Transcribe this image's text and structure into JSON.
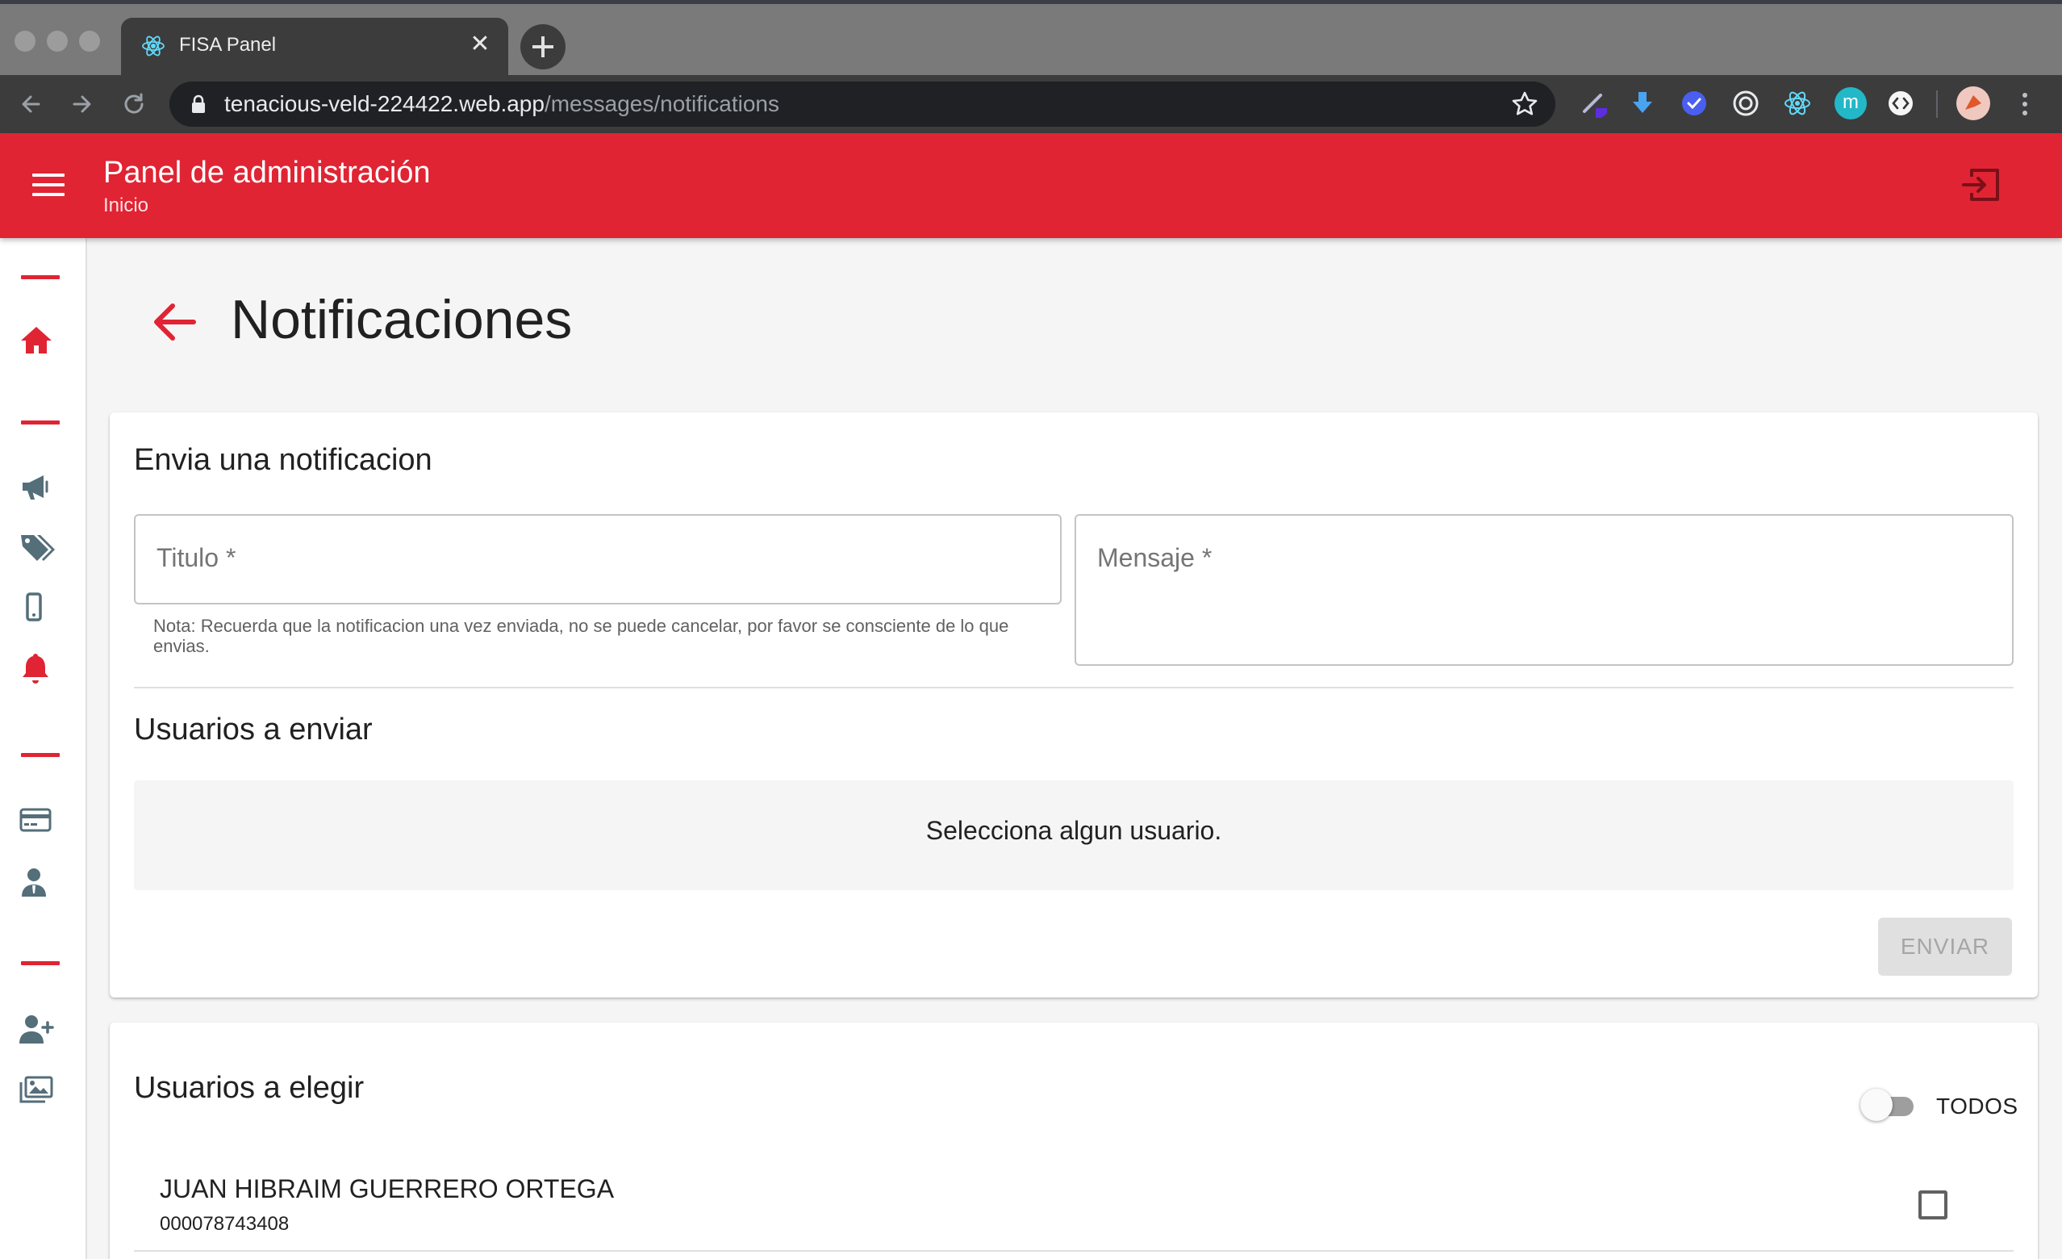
{
  "browser": {
    "tab_title": "FISA Panel",
    "url_host": "tenacious-veld-224422.web.app",
    "url_path": "/messages/notifications",
    "extensions": [
      "pen-extension-icon",
      "download-extension-icon",
      "check-extension-icon",
      "target-extension-icon",
      "react-devtools-icon",
      "m-extension-icon",
      "code-extension-icon"
    ],
    "m_extension_letter": "m"
  },
  "appbar": {
    "title": "Panel de administración",
    "subtitle": "Inicio"
  },
  "page": {
    "title": "Notificaciones"
  },
  "send_card": {
    "heading": "Envia una notificacion",
    "title_placeholder": "Titulo *",
    "message_placeholder": "Mensaje *",
    "helper_text": "Nota: Recuerda que la notificacion una vez enviada, no se puede cancelar, por favor se consciente de lo que envias.",
    "recipients_heading": "Usuarios a enviar",
    "empty_text": "Selecciona algun usuario.",
    "send_label": "ENVIAR"
  },
  "choose_card": {
    "heading": "Usuarios a elegir",
    "toggle_label": "TODOS",
    "users": [
      {
        "name": "JUAN HIBRAIM GUERRERO ORTEGA",
        "id": "000078743408",
        "checked": false
      }
    ]
  },
  "colors": {
    "brand": "#e02433",
    "text": "#212121"
  }
}
